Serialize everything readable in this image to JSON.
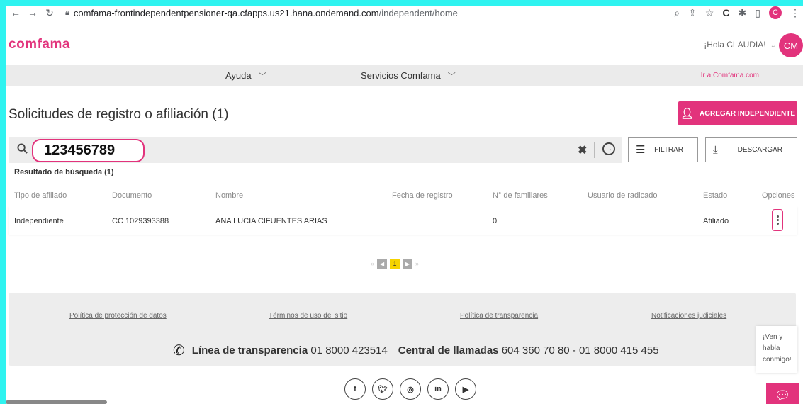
{
  "browser": {
    "url_host": "comfama-frontindependentpensioner-qa.cfapps.us21.hana.ondemand.com",
    "url_path": "/independent/home",
    "profile_initial": "C"
  },
  "header": {
    "logo": "comfama",
    "greeting": "¡Hola CLAUDIA!",
    "avatar_initials": "CM"
  },
  "menu": {
    "items": [
      {
        "label": "Ayuda"
      },
      {
        "label": "Servicios Comfama"
      }
    ],
    "external_link": "Ir a Comfama.com"
  },
  "page": {
    "title": "Solicitudes de registro o afiliación (1)",
    "add_button": "AGREGAR INDEPENDIENTE"
  },
  "search": {
    "value": "123456789"
  },
  "toolbar": {
    "filter_label": "FILTRAR",
    "download_label": "DESCARGAR"
  },
  "results": {
    "label": "Resultado de búsqueda (1)"
  },
  "table": {
    "columns": [
      "Tipo de afiliado",
      "Documento",
      "Nombre",
      "Fecha de registro",
      "N° de familiares",
      "Usuario de radicado",
      "Estado",
      "Opciones"
    ],
    "rows": [
      {
        "tipo": "Independiente",
        "documento": "CC 1029393388",
        "nombre": "ANA LUCIA CIFUENTES ARIAS",
        "fecha": "",
        "familiares": "0",
        "usuario": "",
        "estado": "Afiliado"
      }
    ]
  },
  "pagination": {
    "current_page": "1"
  },
  "footer": {
    "links": [
      "Política de protección de datos",
      "Términos de uso del sitio",
      "Política de transparencia",
      "Notificaciones judiciales"
    ],
    "transparency_label": "Línea de transparencia",
    "transparency_number": "01 8000 423514",
    "callcenter_label": "Central de llamadas",
    "callcenter_number": "604 360 70 80 - 01 8000 415 455"
  },
  "chat": {
    "line1": "¡Ven y",
    "line2": "habla",
    "line3": "conmigo!"
  },
  "colors": {
    "brand": "#e2337c",
    "page_current": "#f5d300",
    "frame_border": "#2ff3f0"
  }
}
